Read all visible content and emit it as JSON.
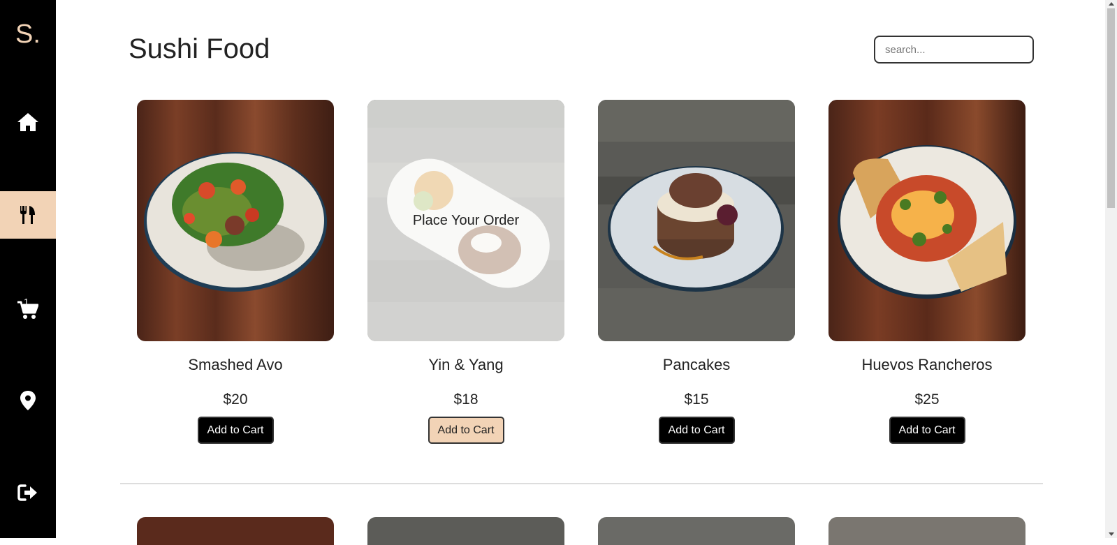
{
  "app": {
    "logo": "S.",
    "title": "Sushi Food"
  },
  "sidebar": {
    "items": [
      {
        "icon": "home-icon",
        "active": false
      },
      {
        "icon": "utensils-icon",
        "active": true
      },
      {
        "icon": "cart-icon",
        "active": false,
        "badge": "1"
      },
      {
        "icon": "location-pin-icon",
        "active": false
      },
      {
        "icon": "sign-out-icon",
        "active": false
      }
    ],
    "accent": "#f2d3b6"
  },
  "search": {
    "placeholder": "search...",
    "value": ""
  },
  "menu": {
    "items": [
      {
        "name": "Smashed Avo",
        "price": "$20",
        "button": "Add to Cart",
        "overlay": ""
      },
      {
        "name": "Yin & Yang",
        "price": "$18",
        "button": "Add to Cart",
        "overlay": "Place Your Order"
      },
      {
        "name": "Pancakes",
        "price": "$15",
        "button": "Add to Cart",
        "overlay": ""
      },
      {
        "name": "Huevos Rancheros",
        "price": "$25",
        "button": "Add to Cart",
        "overlay": ""
      }
    ]
  }
}
